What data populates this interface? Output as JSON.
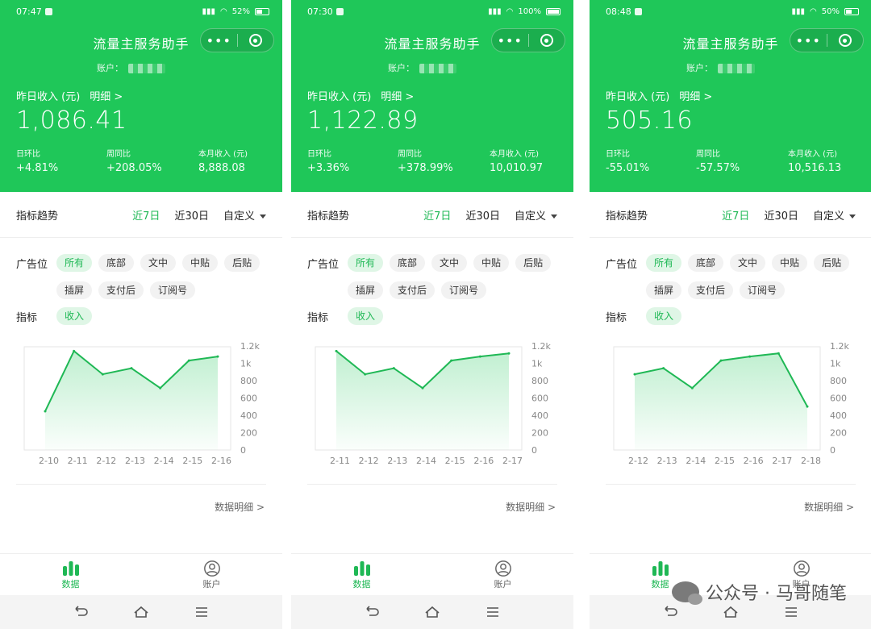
{
  "colors": {
    "accent": "#1fc759",
    "active_text": "#1fb855",
    "chip_active_bg": "#dff6e6"
  },
  "common": {
    "title": "流量主服务助手",
    "capsule_more": "•••",
    "account_label": "账户：",
    "yesterday_label": "昨日收入 (元)",
    "detail_link": "明细 >",
    "dod_label": "日环比",
    "wow_label": "周同比",
    "month_label": "本月收入 (元)",
    "trend_title": "指标趋势",
    "tab_7d": "近7日",
    "tab_30d": "近30日",
    "tab_custom": "自定义",
    "ad_slot_label": "广告位",
    "metric_label": "指标",
    "metric_chip": "收入",
    "chips": [
      "所有",
      "底部",
      "文中",
      "中贴",
      "后贴",
      "插屏",
      "支付后",
      "订阅号"
    ],
    "y_ticks": [
      "1.2k",
      "1k",
      "800",
      "600",
      "400",
      "200",
      "0"
    ],
    "data_detail": "数据明细 >",
    "tab_data": "数据",
    "tab_account": "账户"
  },
  "phones": [
    {
      "status_time": "07:47",
      "status_battery": "52%",
      "yesterday": "1,086.41",
      "dod": "+4.81%",
      "wow": "+208.05%",
      "month": "8,888.08",
      "chart_data": {
        "type": "area",
        "categories": [
          "2-10",
          "2-11",
          "2-12",
          "2-13",
          "2-14",
          "2-15",
          "2-16"
        ],
        "values": [
          450,
          1150,
          880,
          950,
          720,
          1040,
          1086.41
        ],
        "ylim": [
          0,
          1200
        ]
      }
    },
    {
      "status_time": "07:30",
      "status_battery": "100%",
      "yesterday": "1,122.89",
      "dod": "+3.36%",
      "wow": "+378.99%",
      "month": "10,010.97",
      "chart_data": {
        "type": "area",
        "categories": [
          "2-11",
          "2-12",
          "2-13",
          "2-14",
          "2-15",
          "2-16",
          "2-17"
        ],
        "values": [
          1150,
          880,
          950,
          720,
          1040,
          1086.41,
          1122.89
        ],
        "ylim": [
          0,
          1200
        ]
      }
    },
    {
      "status_time": "08:48",
      "status_battery": "50%",
      "yesterday": "505.16",
      "dod": "-55.01%",
      "wow": "-57.57%",
      "month": "10,516.13",
      "chart_data": {
        "type": "area",
        "categories": [
          "2-12",
          "2-13",
          "2-14",
          "2-15",
          "2-16",
          "2-17",
          "2-18"
        ],
        "values": [
          880,
          950,
          720,
          1040,
          1086.41,
          1122.89,
          505.16
        ],
        "ylim": [
          0,
          1200
        ]
      }
    }
  ],
  "watermark": "公众号 · 马哥随笔"
}
